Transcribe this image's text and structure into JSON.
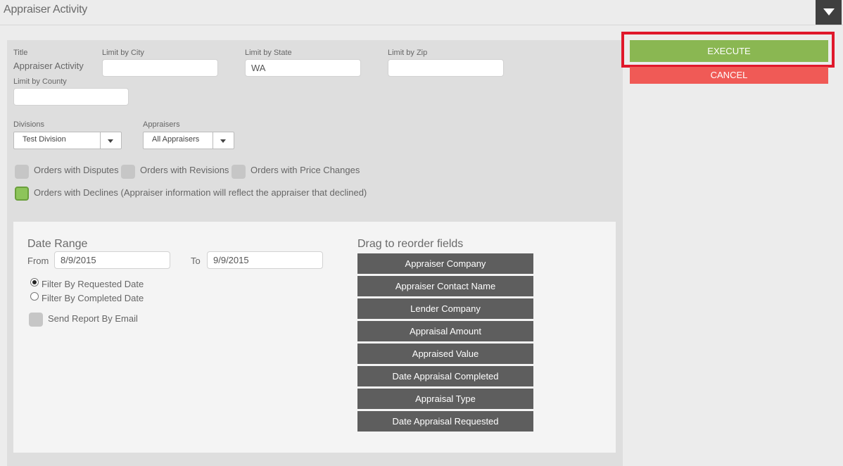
{
  "header": {
    "title": "Appraiser Activity"
  },
  "form": {
    "title_label": "Title",
    "title_value": "Appraiser Activity",
    "city_label": "Limit by City",
    "city_value": "",
    "state_label": "Limit by State",
    "state_value": "WA",
    "zip_label": "Limit by Zip",
    "zip_value": "",
    "county_label": "Limit by County",
    "county_value": "",
    "divisions_label": "Divisions",
    "divisions_value": "Test Division",
    "appraisers_label": "Appraisers",
    "appraisers_value": "All Appraisers",
    "checkboxes": [
      {
        "label": "Orders with Disputes",
        "checked": false
      },
      {
        "label": "Orders with Revisions",
        "checked": false
      },
      {
        "label": "Orders with Price Changes",
        "checked": false
      },
      {
        "label": "Orders with Declines (Appraiser information will reflect the appraiser that declined)",
        "checked": true
      }
    ]
  },
  "date_range": {
    "heading": "Date Range",
    "from_label": "From",
    "from_value": "8/9/2015",
    "to_label": "To",
    "to_value": "9/9/2015",
    "filter_options": [
      {
        "label": "Filter By Requested Date",
        "selected": true
      },
      {
        "label": "Filter By Completed Date",
        "selected": false
      }
    ],
    "email_label": "Send Report By Email"
  },
  "reorder": {
    "heading": "Drag to reorder fields",
    "fields": [
      "Appraiser Company",
      "Appraiser Contact Name",
      "Lender Company",
      "Appraisal Amount",
      "Appraised Value",
      "Date Appraisal Completed",
      "Appraisal Type",
      "Date Appraisal Requested"
    ]
  },
  "actions": {
    "execute": "EXECUTE",
    "cancel": "CANCEL"
  },
  "colors": {
    "execute": "#8ab752",
    "cancel": "#f05a56",
    "highlight": "#e0182b",
    "field_bg": "#5e5e5e"
  }
}
